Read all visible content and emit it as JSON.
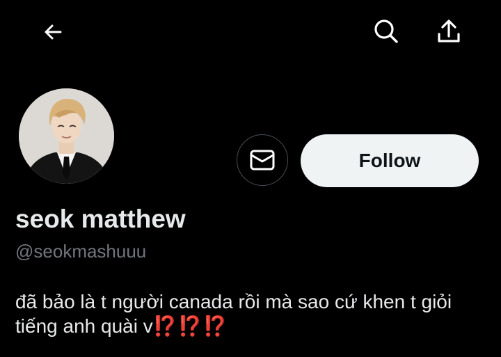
{
  "topbar": {
    "back_icon": "back-arrow-icon",
    "search_icon": "search-icon",
    "share_icon": "share-icon"
  },
  "profile": {
    "display_name": "seok matthew",
    "handle": "@seokmashuuu",
    "bio_text": "đã bảo là t người canada rồi mà sao cứ khen t giỏi tiếng anh quài v",
    "bio_emoji": "⁉️⁉️⁉️"
  },
  "actions": {
    "message_icon": "mail-icon",
    "follow_label": "Follow"
  },
  "colors": {
    "background": "#000000",
    "text_primary": "#e7e9ea",
    "text_secondary": "#71767b",
    "follow_bg": "#eff3f4",
    "follow_text": "#0f1419",
    "emoji_red": "#e0312b"
  }
}
